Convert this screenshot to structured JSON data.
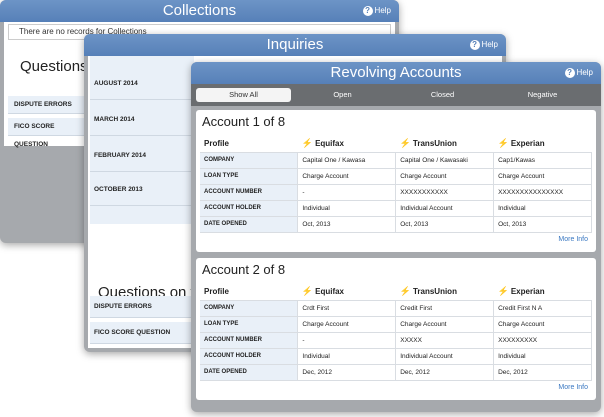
{
  "help_label": "Help",
  "collections": {
    "title": "Collections",
    "no_records": "There are no records for Collections",
    "questions_title": "Questions on",
    "rows": [
      "DISPUTE ERRORS",
      "FICO SCORE QUESTION"
    ]
  },
  "inquiries": {
    "title": "Inquiries",
    "months": [
      "AUGUST 2014",
      "MARCH 2014",
      "FEBRUARY 2014",
      "OCTOBER 2013"
    ],
    "questions_title": "Questions on you",
    "rows": [
      "DISPUTE ERRORS",
      "FICO SCORE QUESTION"
    ]
  },
  "revolving": {
    "title": "Revolving Accounts",
    "tabs": [
      "Show All",
      "Open",
      "Closed",
      "Negative"
    ],
    "header_profile": "Profile",
    "bureaus": [
      "Equifax",
      "TransUnion",
      "Experian"
    ],
    "row_labels": [
      "COMPANY",
      "LOAN TYPE",
      "ACCOUNT NUMBER",
      "ACCOUNT HOLDER",
      "DATE OPENED"
    ],
    "more_info": "More Info",
    "accounts": [
      {
        "title": "Account 1 of 8",
        "rows": [
          [
            "Capital One / Kawasa",
            "Capital One / Kawasaki",
            "Cap1/Kawas"
          ],
          [
            "Charge Account",
            "Charge Account",
            "Charge Account"
          ],
          [
            "-",
            "XXXXXXXXXXX",
            "XXXXXXXXXXXXXXX"
          ],
          [
            "Individual",
            "Individual Account",
            "Individual"
          ],
          [
            "Oct, 2013",
            "Oct, 2013",
            "Oct, 2013"
          ]
        ]
      },
      {
        "title": "Account 2 of 8",
        "rows": [
          [
            "Crdt First",
            "Credit First",
            "Credit First N A"
          ],
          [
            "Charge Account",
            "Charge Account",
            "Charge Account"
          ],
          [
            "-",
            "XXXXX",
            "XXXXXXXXX"
          ],
          [
            "Individual",
            "Individual Account",
            "Individual"
          ],
          [
            "Dec, 2012",
            "Dec, 2012",
            "Dec, 2012"
          ]
        ]
      }
    ]
  }
}
